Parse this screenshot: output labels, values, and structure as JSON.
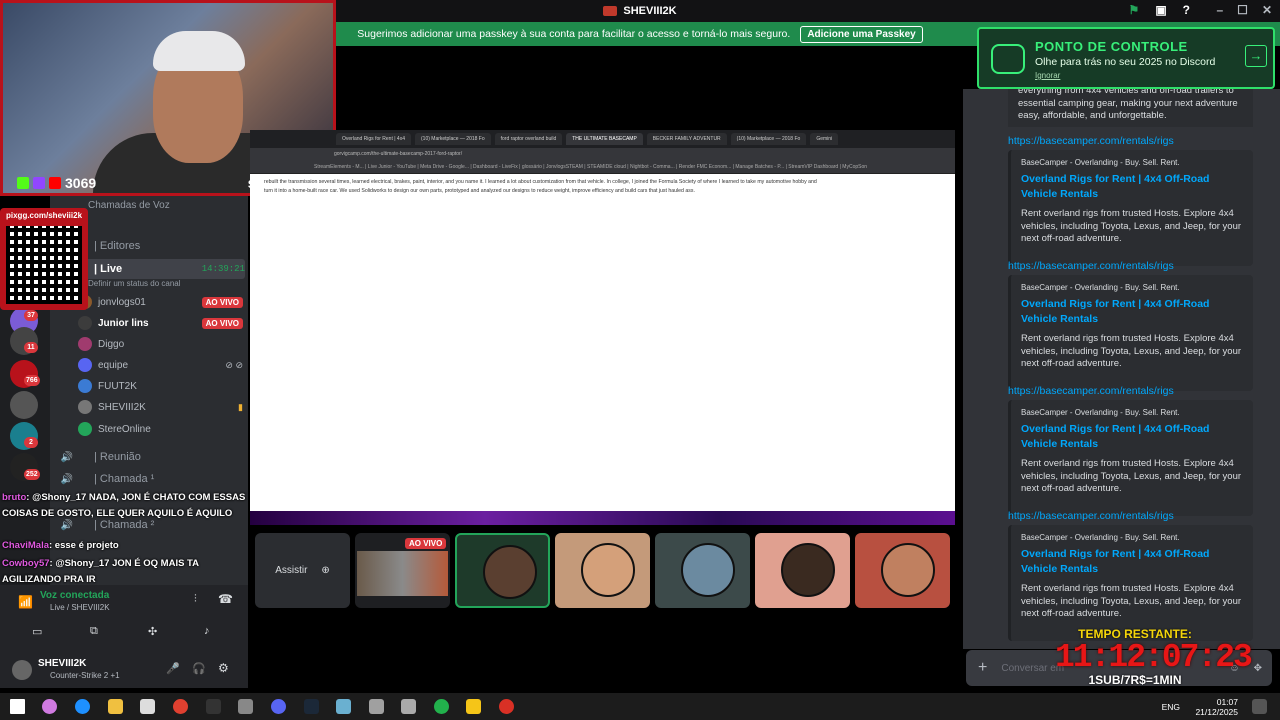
{
  "window": {
    "title": "SHEVIII2K"
  },
  "passkey": {
    "message": "Sugerimos adicionar uma passkey à sua conta para facilitar o acesso e torná-lo mais seguro.",
    "button": "Adicione uma Passkey"
  },
  "webcam": {
    "viewer_count": "3069",
    "streamer_name": "sheviii2k"
  },
  "qr": {
    "url": "pixgg.com/sheviii2k"
  },
  "channels": {
    "section_voice": "Chamadas de Voz",
    "items": [
      {
        "label": "| Editores"
      },
      {
        "label": "| Live",
        "time": "14:39:21",
        "status_placeholder": "Definir um status do canal"
      },
      {
        "label": "| Reunião"
      },
      {
        "label": "| Chamada ¹"
      },
      {
        "label": "| Chamada ²"
      }
    ],
    "members": [
      {
        "name": "jonvlogs01",
        "badge": "AO VIVO"
      },
      {
        "name": "Junior lins",
        "badge": "AO VIVO"
      },
      {
        "name": "Diggo"
      },
      {
        "name": "equipe"
      },
      {
        "name": "FUUT2K"
      },
      {
        "name": "SHEVIII2K"
      },
      {
        "name": "StereOnline"
      }
    ]
  },
  "server_badges": [
    "37",
    "11",
    "766",
    "2",
    "252"
  ],
  "chat_overlay": [
    {
      "user": "bruto",
      "text": ": @Shony_17 NADA, JON É CHATO COM ESSAS COISAS DE GOSTO, ELE QUER AQUILO É AQUILO"
    },
    {
      "user": "ChaviMala",
      "text": ": esse é projeto"
    },
    {
      "user": "Cowboy57",
      "text": ": @Shony_17 JON É OQ MAIS TA AGILIZANDO PRA IR"
    }
  ],
  "voice": {
    "status": "Voz conectada",
    "channel": "Live / SHEVIII2K"
  },
  "user": {
    "name": "SHEVIII2K",
    "activity": "Counter-Strike 2 +1"
  },
  "stream": {
    "tabs": [
      "Overland Rigs for Rent | 4x4",
      "(10) Marketplace — 2018 Fo",
      "ford raptor overland build",
      "THE ULTIMATE BASECAMP",
      "BECKER FAMILY ADVENTUR",
      "(10) Marketplace — 2018 Fo",
      "Gemini"
    ],
    "url": "gorvigcamp.com/the-ultimate-basecamp-2017-ford-raptor/",
    "bookmarks": "StreamElements - M... | Live Junior - YouTube | Meta Drive - Google... | Dashboard - LiveFix | glossário | JonvlogsSTEAM | STEAMIDE cloud | Nightbot - Comma... | Render FMC Econom... | Manage Batches - P... | StreamVIP Dashboard | MyCopSon",
    "page_text": "rebuilt the transmission several times, learned electrical, brakes, paint, interior, and you name it. I learned a lot about customization from that vehicle. In college, I joined the Formula Society of where I learned to take my automotive hobby and turn it into a home-built race car. We used Solidworks to design our own parts, prototyped and analyzed our designs to reduce weight, improve efficiency and build cars that just hauled ass."
  },
  "tiles": {
    "watch_label": "Assistir",
    "live_badge": "AO VIVO"
  },
  "banner": {
    "title": "PONTO DE CONTROLE",
    "subtitle": "Olhe para trás no seu 2025 no Discord",
    "dismiss": "Ignorar"
  },
  "messages": {
    "first_desc": "everything from 4x4 vehicles and off-road trailers to essential camping gear, making your next adventure easy, affordable, and unforgettable.",
    "embeds": [
      {
        "link": "https://basecamper.com/rentals/rigs",
        "site": "BaseCamper - Overlanding - Buy. Sell. Rent.",
        "title": "Overland Rigs for Rent | 4x4 Off-Road Vehicle Rentals",
        "desc": "Rent overland rigs from trusted Hosts. Explore 4x4 vehicles, including Toyota, Lexus, and Jeep, for your next off-road adventure."
      },
      {
        "link": "https://basecamper.com/rentals/rigs",
        "site": "BaseCamper - Overlanding - Buy. Sell. Rent.",
        "title": "Overland Rigs for Rent | 4x4 Off-Road Vehicle Rentals",
        "desc": "Rent overland rigs from trusted Hosts. Explore 4x4 vehicles, including Toyota, Lexus, and Jeep, for your next off-road adventure."
      },
      {
        "link": "https://basecamper.com/rentals/rigs",
        "site": "BaseCamper - Overlanding - Buy. Sell. Rent.",
        "title": "Overland Rigs for Rent | 4x4 Off-Road Vehicle Rentals",
        "desc": "Rent overland rigs from trusted Hosts. Explore 4x4 vehicles, including Toyota, Lexus, and Jeep, for your next off-road adventure."
      },
      {
        "link": "https://basecamper.com/rentals/rigs",
        "site": "BaseCamper - Overlanding - Buy. Sell. Rent.",
        "title": "Overland Rigs for Rent | 4x4 Off-Road Vehicle Rentals",
        "desc": "Rent overland rigs from trusted Hosts. Explore 4x4 vehicles, including Toyota, Lexus, and Jeep, for your next off-road adventure."
      }
    ],
    "input_placeholder": "Conversar em"
  },
  "timer": {
    "label": "TEMPO RESTANTE:",
    "value": "11:12:07:23",
    "rate": "1SUB/7R$=1MIN"
  },
  "taskbar": {
    "lang": "ENG",
    "time": "01:07",
    "date": "21/12/2025"
  },
  "colors": {
    "discord_bg": "#313338",
    "link": "#00a8fc",
    "live_red": "#da373c",
    "banner_green": "#38f07a",
    "timer_red": "#e81616",
    "timer_yellow": "#f5d60a"
  }
}
